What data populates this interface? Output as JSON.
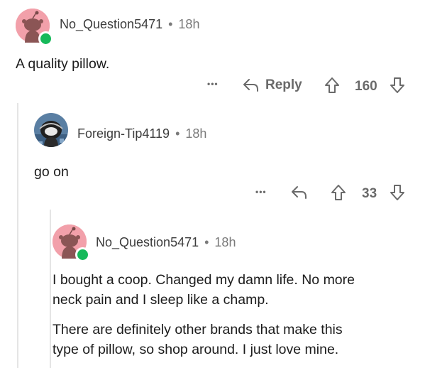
{
  "comments": [
    {
      "username": "No_Question5471",
      "separator": "•",
      "time": "18h",
      "body": [
        "A quality pillow."
      ],
      "more": "•••",
      "reply_label": "Reply",
      "votes": "160"
    },
    {
      "username": "Foreign-Tip4119",
      "separator": "•",
      "time": "18h",
      "body": [
        "go on"
      ],
      "more": "•••",
      "votes": "33"
    },
    {
      "username": "No_Question5471",
      "separator": "•",
      "time": "18h",
      "body": [
        "I bought a coop.  Changed my damn life.  No more",
        "neck pain and I sleep like a champ.",
        "There are definitely other brands that make this",
        "type of pillow, so shop around. I just love mine."
      ]
    }
  ],
  "colors": {
    "avatar_pink": "#f2a0aa",
    "online_green": "#16b95a",
    "thread_line": "#e5e5e5"
  }
}
